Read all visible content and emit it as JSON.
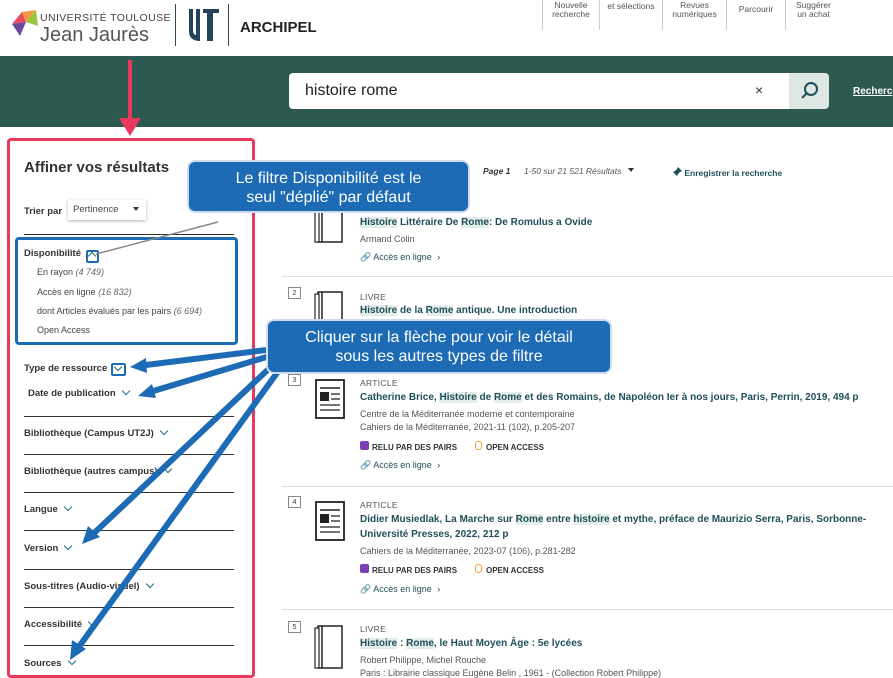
{
  "header": {
    "logo_line1": "UNIVERSITÉ TOULOUSE",
    "logo_line2": "Jean Jaurès",
    "app_name": "ARCHIPEL",
    "nav": [
      {
        "label": "Nouvelle recherche",
        "icon": "new-search-icon"
      },
      {
        "label": "Nouveautés et sélections",
        "icon": "new-items-icon"
      },
      {
        "label": "Revues numériques",
        "icon": "journals-icon"
      },
      {
        "label": "Parcourir",
        "icon": "browse-icon"
      },
      {
        "label": "Suggérer un achat",
        "icon": "suggest-icon"
      }
    ]
  },
  "search": {
    "value": "histoire rome",
    "clear": "×",
    "advanced": "Recherc"
  },
  "sidebar": {
    "title": "Affiner vos résultats",
    "sort_label": "Trier par",
    "sort_value": "Pertinence",
    "availability": {
      "title": "Disponibilité",
      "items": [
        {
          "label": "En rayon",
          "count": "(4 749)"
        },
        {
          "label": "Accès en ligne",
          "count": "(16 832)"
        },
        {
          "label": "dont Articles évalués par les pairs",
          "count": "(6 694)"
        },
        {
          "label": "Open Access",
          "count": ""
        }
      ]
    },
    "filters": [
      "Type de ressource",
      "Date de publication",
      "Bibliothèque (Campus UT2J)",
      "Bibliothèque (autres campus)",
      "Langue",
      "Version",
      "Sous-titres (Audio-visuel)",
      "Accessibilité",
      "Sources"
    ]
  },
  "results_bar": {
    "page": "Page 1",
    "range": "1-50 sur 21 521 Résultats",
    "save": "Enregistrer la recherche"
  },
  "results": [
    {
      "num": "",
      "type": "",
      "title_parts": [
        [
          "Histoire",
          true
        ],
        [
          " Littéraire De ",
          false
        ],
        [
          "Rome",
          true
        ],
        [
          ": De Romulus a Ovide",
          false
        ]
      ],
      "lines": [
        "Armand Colin"
      ],
      "badges": [],
      "link": "Accès en ligne"
    },
    {
      "num": "2",
      "type": "LIVRE",
      "title_parts": [
        [
          "Histoire",
          true
        ],
        [
          " de la ",
          false
        ],
        [
          "Rome",
          true
        ],
        [
          " antique. Une introduction",
          false
        ]
      ],
      "lines": [],
      "badges": [],
      "link": ""
    },
    {
      "num": "3",
      "type": "ARTICLE",
      "title_parts": [
        [
          "Catherine Brice, ",
          false
        ],
        [
          "Histoire",
          true
        ],
        [
          " de ",
          false
        ],
        [
          "Rome",
          true
        ],
        [
          " et des Romains, de Napoléon Ier à nos jours, Paris, Perrin, 2019, 494 p",
          false
        ]
      ],
      "lines": [
        "Centre de la Méditerranée moderne et contemporaine",
        "Cahiers de la Méditerranée, 2021-11 (102), p.205-207"
      ],
      "badges": [
        "RELU PAR DES PAIRS",
        "OPEN ACCESS"
      ],
      "link": "Accès en ligne"
    },
    {
      "num": "4",
      "type": "ARTICLE",
      "title_parts": [
        [
          "Didier Musiedlak, La Marche sur ",
          false
        ],
        [
          "Rome",
          true
        ],
        [
          " entre ",
          false
        ],
        [
          "histoire",
          true
        ],
        [
          " et mythe, préface de Maurizio Serra, Paris, Sorbonne-",
          false
        ]
      ],
      "title_line2": "Université Presses, 2022, 212 p",
      "lines": [
        "Cahiers de la Méditerranée, 2023-07 (106), p.281-282"
      ],
      "badges": [
        "RELU PAR DES PAIRS",
        "OPEN ACCESS"
      ],
      "link": "Accès en ligne"
    },
    {
      "num": "5",
      "type": "LIVRE",
      "title_parts": [
        [
          "Histoire",
          true
        ],
        [
          " : ",
          false
        ],
        [
          "Rome",
          true
        ],
        [
          ", le Haut Moyen Âge : 5e lycées",
          false
        ]
      ],
      "lines": [
        "Robert Philippe, Michel Rouche",
        "Paris : Librairie classique Eugène Belin , 1961 - (Collection Robert Philippe)"
      ],
      "badges": [],
      "link": ""
    }
  ],
  "annotations": {
    "callout1": [
      "Le filtre Disponibilité est le",
      "seul \"déplié\" par défaut"
    ],
    "callout2": [
      "Cliquer sur la flèche pour voir le détail",
      "sous les autres types de filtre"
    ],
    "pink": "#e8385e",
    "blue": "#1d6bb5"
  },
  "colors": {
    "banner": "#2d5a50",
    "title": "#1f4f5a",
    "accent": "#1a6b7e"
  }
}
